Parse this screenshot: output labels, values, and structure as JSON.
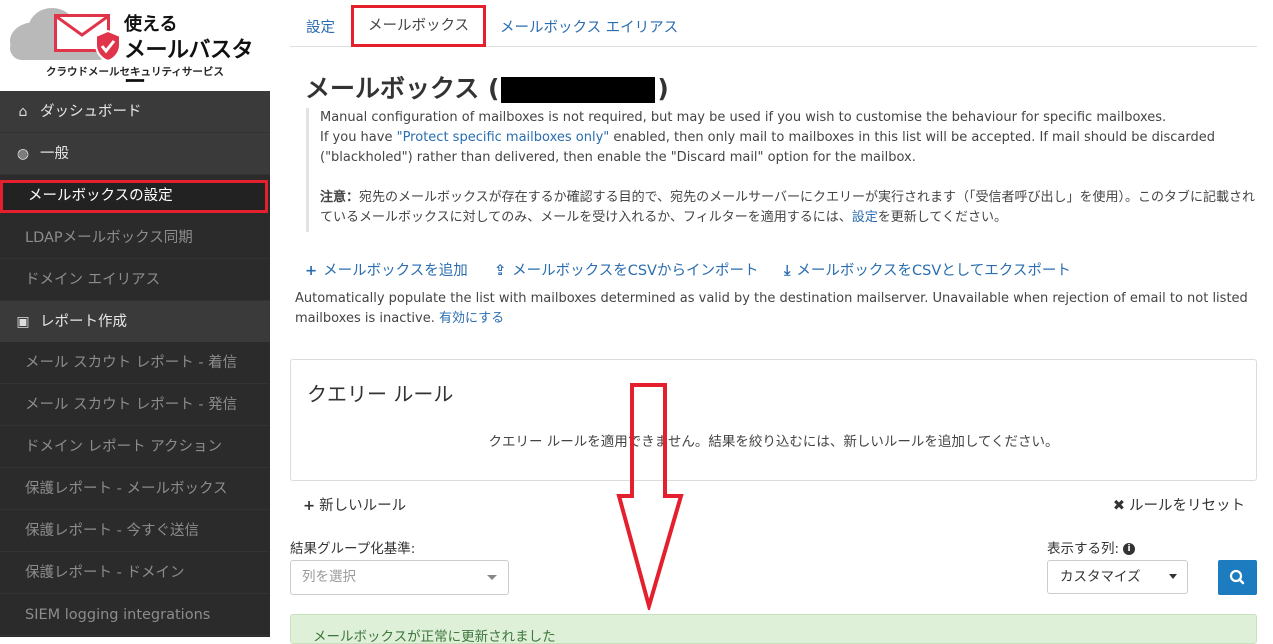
{
  "brand": {
    "name_line1": "使える",
    "name_line2": "メールバスター",
    "tagline": "クラウドメールセキュリティサービス",
    "accent": "#e0344a"
  },
  "sidebar": {
    "sections": [
      {
        "label": "ダッシュボード",
        "icon": "home-icon"
      },
      {
        "label": "一般",
        "icon": "globe-icon"
      },
      {
        "label": "レポート作成",
        "icon": "inbox-icon"
      }
    ],
    "items_general": [
      {
        "label": "メールボックスの設定",
        "active": true
      },
      {
        "label": "LDAPメールボックス同期"
      },
      {
        "label": "ドメイン エイリアス"
      }
    ],
    "items_reports": [
      {
        "label": "メール スカウト レポート - 着信"
      },
      {
        "label": "メール スカウト レポート - 発信"
      },
      {
        "label": "ドメイン レポート アクション"
      },
      {
        "label": "保護レポート - メールボックス"
      },
      {
        "label": "保護レポート - 今すぐ送信"
      },
      {
        "label": "保護レポート - ドメイン"
      },
      {
        "label": "SIEM logging integrations"
      }
    ]
  },
  "tabs": {
    "settings": "設定",
    "mailbox": "メールボックス",
    "alias": "メールボックス エイリアス"
  },
  "page": {
    "title_prefix": "メールボックス (",
    "title_suffix": ")"
  },
  "notice": {
    "line1": "Manual configuration of mailboxes is not required, but may be used if you wish to customise the behaviour for specific mailboxes.",
    "line2_a": "If you have ",
    "line2_link": "\"Protect specific mailboxes only\"",
    "line2_b": " enabled, then only mail to mailboxes in this list will be accepted. If mail should be discarded",
    "line3": "(\"blackholed\") rather than delivered, then enable the \"Discard mail\" option for the mailbox.",
    "note_label": "注意：",
    "note_text_a": "宛先のメールボックスが存在するか確認する目的で、宛先のメールサーバーにクエリーが実行されます（「受信者呼び出し」を使用）。このタブに記載されているメールボックスに対してのみ、メールを受け入れるか、フィルターを適用するには、",
    "note_link": "設定",
    "note_text_b": "を更新してください。"
  },
  "actions": {
    "add": "メールボックスを追加",
    "import_csv": "メールボックスをCSVからインポート",
    "export_csv": "メールボックスをCSVとしてエクスポート"
  },
  "auto": {
    "text": "Automatically populate the list with mailboxes determined as valid by the destination mailserver. Unavailable when rejection of email to not listed mailboxes is inactive. ",
    "link": "有効にする"
  },
  "query_panel": {
    "title": "クエリー ルール",
    "message": "クエリー ルールを適用できません。結果を絞り込むには、新しいルールを追加してください。"
  },
  "rules": {
    "new": "新しいルール",
    "reset": "ルールをリセット"
  },
  "filters": {
    "group_label": "結果グループ化基準:",
    "group_placeholder": "列を選択",
    "columns_label": "表示する列:",
    "columns_value": "カスタマイズ"
  },
  "alert": {
    "text": "メールボックスが正常に更新されました"
  }
}
